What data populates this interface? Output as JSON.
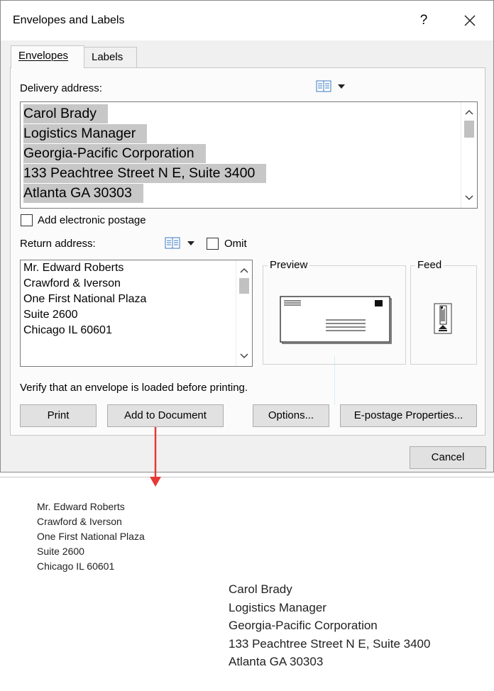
{
  "dialog": {
    "title": "Envelopes and Labels",
    "help_label": "?",
    "close_label": "✕"
  },
  "tabs": {
    "envelopes_label": "Envelopes",
    "labels_label": "Labels"
  },
  "delivery": {
    "label": "Delivery address:",
    "lines": [
      "Carol Brady",
      "Logistics Manager",
      "Georgia-Pacific Corporation",
      "133 Peachtree Street N E, Suite 3400",
      "Atlanta GA 30303"
    ],
    "address_book_icon": "address-book-icon"
  },
  "postage": {
    "label": "Add electronic postage",
    "checked": false
  },
  "return": {
    "label": "Return address:",
    "omit_label": "Omit",
    "omit_checked": false,
    "lines": [
      "Mr. Edward Roberts",
      "Crawford & Iverson",
      "One First National Plaza",
      "Suite 2600",
      "Chicago IL 60601"
    ]
  },
  "preview": {
    "title": "Preview"
  },
  "feed": {
    "title": "Feed"
  },
  "status_text": "Verify that an envelope is loaded before printing.",
  "buttons": {
    "print": "Print",
    "add_to_document": "Add to Document",
    "options": "Options...",
    "epostage": "E-postage Properties...",
    "cancel": "Cancel"
  },
  "document": {
    "return_lines": [
      "Mr. Edward Roberts",
      "Crawford & Iverson",
      "One First National Plaza",
      "Suite 2600",
      "Chicago IL 60601"
    ],
    "delivery_lines": [
      "Carol Brady",
      "Logistics Manager",
      "Georgia-Pacific Corporation",
      "133 Peachtree Street N E, Suite 3400",
      "Atlanta GA 30303"
    ]
  },
  "colors": {
    "dialog_bg": "#f0f0f0",
    "panel_bg": "#fbfbfb",
    "selection": "#c7c7c7",
    "arrow": "#e53935"
  }
}
